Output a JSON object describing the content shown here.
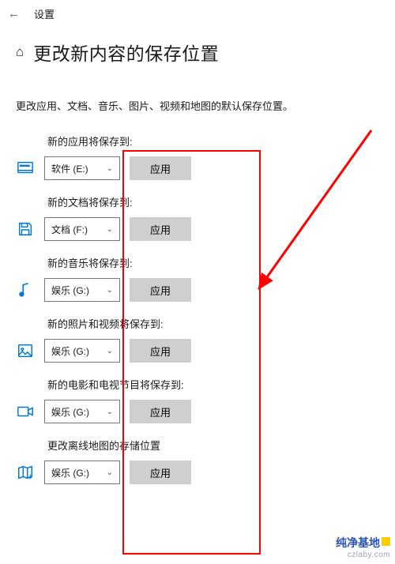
{
  "top": {
    "back_icon": "←",
    "settings": "设置"
  },
  "header": {
    "home_icon": "⌂",
    "title": "更改新内容的保存位置"
  },
  "subtitle": "更改应用、文档、音乐、图片、视频和地图的默认保存位置。",
  "apply_label": "应用",
  "settings_list": [
    {
      "key": "apps",
      "label": "新的应用将保存到:",
      "value": "软件 (E:)"
    },
    {
      "key": "docs",
      "label": "新的文档将保存到:",
      "value": "文档 (F:)"
    },
    {
      "key": "music",
      "label": "新的音乐将保存到:",
      "value": "娱乐 (G:)"
    },
    {
      "key": "photos",
      "label": "新的照片和视频将保存到:",
      "value": "娱乐 (G:)"
    },
    {
      "key": "movies",
      "label": "新的电影和电视节目将保存到:",
      "value": "娱乐 (G:)"
    },
    {
      "key": "maps",
      "label": "更改离线地图的存储位置",
      "value": "娱乐 (G:)"
    }
  ],
  "colors": {
    "accent": "#0078d4",
    "annotation": "#ff0000"
  },
  "watermark": {
    "line1": "纯净基地",
    "line2": "czlaby.com"
  }
}
